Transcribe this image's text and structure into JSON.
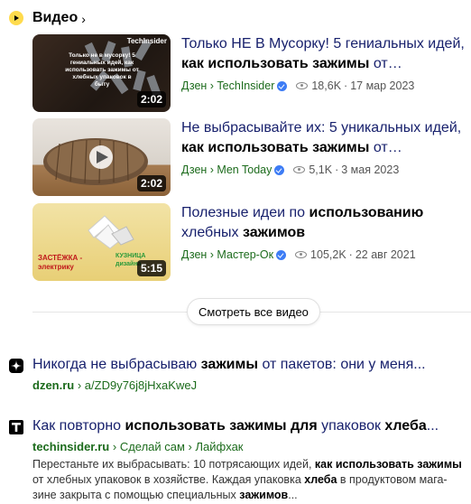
{
  "video_block": {
    "title": "Видео",
    "chevron": "›",
    "show_all_label": "Смотреть все видео",
    "items": [
      {
        "title_pre": "Только НЕ В Мусорку! 5 гениальных идей, ",
        "title_bold": "как использовать зажимы",
        "title_post": " от…",
        "source": "Дзен › TechInsider",
        "views": "18,6K",
        "date": "17 мар 2023",
        "duration": "2:02",
        "thumb_brand": "TechInsider",
        "thumb_text": "Только не в мусорку! 5 гениальных идей, как использовать зажимы от хлебных упаковок в быту"
      },
      {
        "title_pre": "Не выбрасывайте их: 5 уникальных идей, ",
        "title_bold": "как использовать зажимы",
        "title_post": " от…",
        "source": "Дзен › Men Today",
        "views": "5,1K",
        "date": "3 мая 2023",
        "duration": "2:02"
      },
      {
        "title_pre": "Полезные идеи по ",
        "title_bold": "использованию",
        "title_mid": " хлебных ",
        "title_bold2": "зажимов",
        "source": "Дзен › Мастер-Ок",
        "views": "105,2K",
        "date": "22 авг 2021",
        "duration": "5:15",
        "thumb_text1": "ЗАСТЁЖКА - электрику",
        "thumb_text2": "КУЗНИЦА дизайна"
      }
    ]
  },
  "results": [
    {
      "title_pre": "Никогда не выбрасываю ",
      "title_bold": "зажимы",
      "title_post": " от пакетов: они у меня...",
      "domain": "dzen.ru",
      "path": "› a/ZD9y76j8jHxaKweJ",
      "favicon": "dzen-icon"
    },
    {
      "title_pre": "Как повторно ",
      "title_bold": "использовать зажимы для",
      "title_mid": " упаковок ",
      "title_bold2": "хлеба",
      "title_post": "...",
      "domain": "techinsider.ru",
      "path": "› Сделай сам › Лайфхак",
      "favicon": "techinsider-icon",
      "snippet_1": "Перестаньте их выбрасывать: 10 потрясающих идей, ",
      "snippet_b1": "как использовать зажимы",
      "snippet_2": " от хлебных упаковок в хозяйстве. Каждая упаковка ",
      "snippet_b2": "хлеба",
      "snippet_3": " в продуктовом мага-зине закрыта с помощью специальных ",
      "snippet_b3": "зажимов",
      "snippet_4": "..."
    }
  ]
}
